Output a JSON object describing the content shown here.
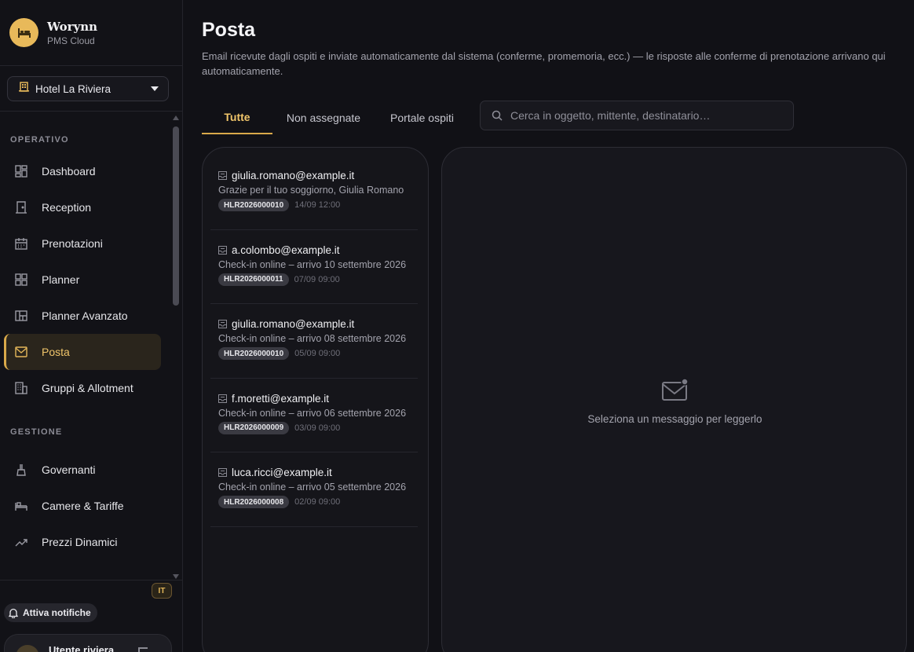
{
  "brand": {
    "name": "Worynn",
    "subtitle": "PMS Cloud",
    "accent": "#e8b95a"
  },
  "hotel_select": {
    "value": "Hotel La Riviera"
  },
  "nav": {
    "section_operativo": "OPERATIVO",
    "section_gestione": "GESTIONE",
    "items": [
      {
        "label": "Dashboard",
        "icon": "dashboard-icon"
      },
      {
        "label": "Reception",
        "icon": "door-icon"
      },
      {
        "label": "Prenotazioni",
        "icon": "calendar-icon"
      },
      {
        "label": "Planner",
        "icon": "grid-icon"
      },
      {
        "label": "Planner Avanzato",
        "icon": "layout-icon"
      },
      {
        "label": "Posta",
        "icon": "mail-icon",
        "active": true
      },
      {
        "label": "Gruppi & Allotment",
        "icon": "building-icon"
      },
      {
        "label": "Governanti",
        "icon": "broom-icon"
      },
      {
        "label": "Camere & Tariffe",
        "icon": "bed-icon"
      },
      {
        "label": "Prezzi Dinamici",
        "icon": "trend-icon"
      }
    ]
  },
  "footer": {
    "lang": "IT",
    "notifications": "Attiva notifiche",
    "user_name": "Utente riviera"
  },
  "page": {
    "title": "Posta",
    "description": "Email ricevute dagli ospiti e inviate automaticamente dal sistema (conferme, promemoria, ecc.) — le risposte alle conferme di prenotazione arrivano qui automaticamente."
  },
  "tabs": [
    "Tutte",
    "Non assegnate",
    "Portale ospiti"
  ],
  "search": {
    "placeholder": "Cerca in oggetto, mittente, destinatario…"
  },
  "messages": [
    {
      "from": "giulia.romano@example.it",
      "subject": "Grazie per il tuo soggiorno, Giulia Romano",
      "code": "HLR2026000010",
      "time": "14/09 12:00"
    },
    {
      "from": "a.colombo@example.it",
      "subject": "Check-in online – arrivo 10 settembre 2026",
      "code": "HLR2026000011",
      "time": "07/09 09:00"
    },
    {
      "from": "giulia.romano@example.it",
      "subject": "Check-in online – arrivo 08 settembre 2026",
      "code": "HLR2026000010",
      "time": "05/09 09:00"
    },
    {
      "from": "f.moretti@example.it",
      "subject": "Check-in online – arrivo 06 settembre 2026",
      "code": "HLR2026000009",
      "time": "03/09 09:00"
    },
    {
      "from": "luca.ricci@example.it",
      "subject": "Check-in online – arrivo 05 settembre 2026",
      "code": "HLR2026000008",
      "time": "02/09 09:00"
    }
  ],
  "detail": {
    "empty_text": "Seleziona un messaggio per leggerlo"
  }
}
